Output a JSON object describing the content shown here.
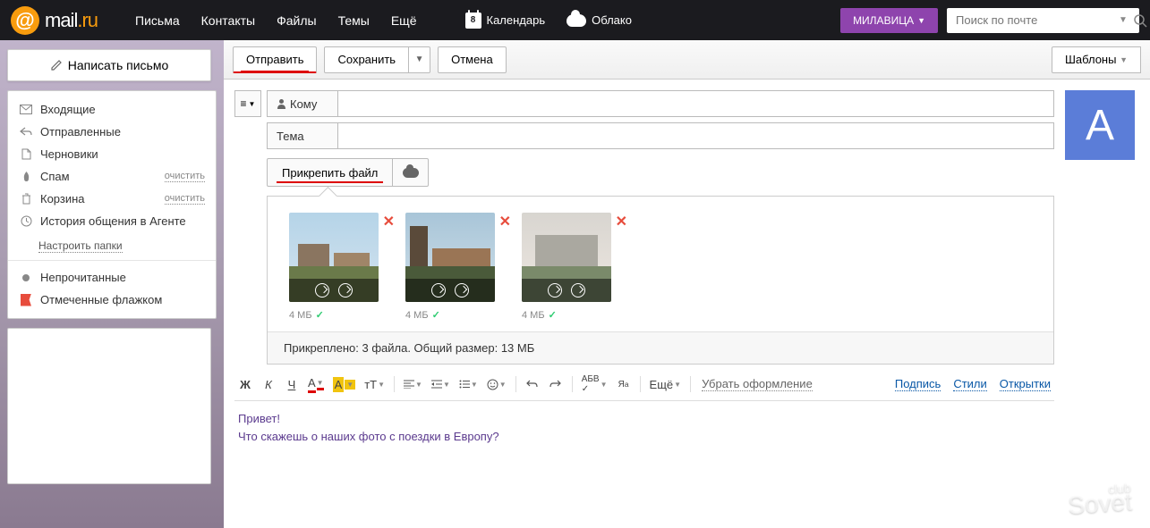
{
  "header": {
    "logo_text_main": "mail",
    "logo_text_domain": ".ru",
    "nav": [
      "Письма",
      "Контакты",
      "Файлы",
      "Темы",
      "Ещё"
    ],
    "calendar_label": "Календарь",
    "calendar_day": "8",
    "cloud_label": "Облако",
    "user_label": "МИЛАВИЦА",
    "search_placeholder": "Поиск по почте"
  },
  "sidebar": {
    "compose": "Написать письмо",
    "items": [
      {
        "label": "Входящие"
      },
      {
        "label": "Отправленные"
      },
      {
        "label": "Черновики"
      },
      {
        "label": "Спам",
        "clear": "очистить"
      },
      {
        "label": "Корзина",
        "clear": "очистить"
      },
      {
        "label": "История общения в Агенте"
      }
    ],
    "configure": "Настроить папки",
    "extras": [
      {
        "label": "Непрочитанные"
      },
      {
        "label": "Отмеченные флажком"
      }
    ]
  },
  "actions": {
    "send": "Отправить",
    "save": "Сохранить",
    "cancel": "Отмена",
    "templates": "Шаблоны"
  },
  "compose": {
    "to_label": "Кому",
    "subject_label": "Тема",
    "attach_label": "Прикрепить файл",
    "avatar_letter": "А"
  },
  "attachments": {
    "items": [
      {
        "size": "4 МБ"
      },
      {
        "size": "4 МБ"
      },
      {
        "size": "4 МБ"
      }
    ],
    "summary": "Прикреплено: 3 файла. Общий размер: 13 МБ"
  },
  "toolbar": {
    "bold": "Ж",
    "italic": "К",
    "under": "Ч",
    "color": "А",
    "bg": "А",
    "size": "тТ",
    "more": "Ещё",
    "remove_fmt": "Убрать оформление",
    "link_signature": "Подпись",
    "link_styles": "Стили",
    "link_cards": "Открытки"
  },
  "body": {
    "line1": "Привет!",
    "line2": "Что скажешь о наших фото с поездки в Европу?"
  },
  "watermark": {
    "small": "club",
    "big": "Sovet"
  }
}
